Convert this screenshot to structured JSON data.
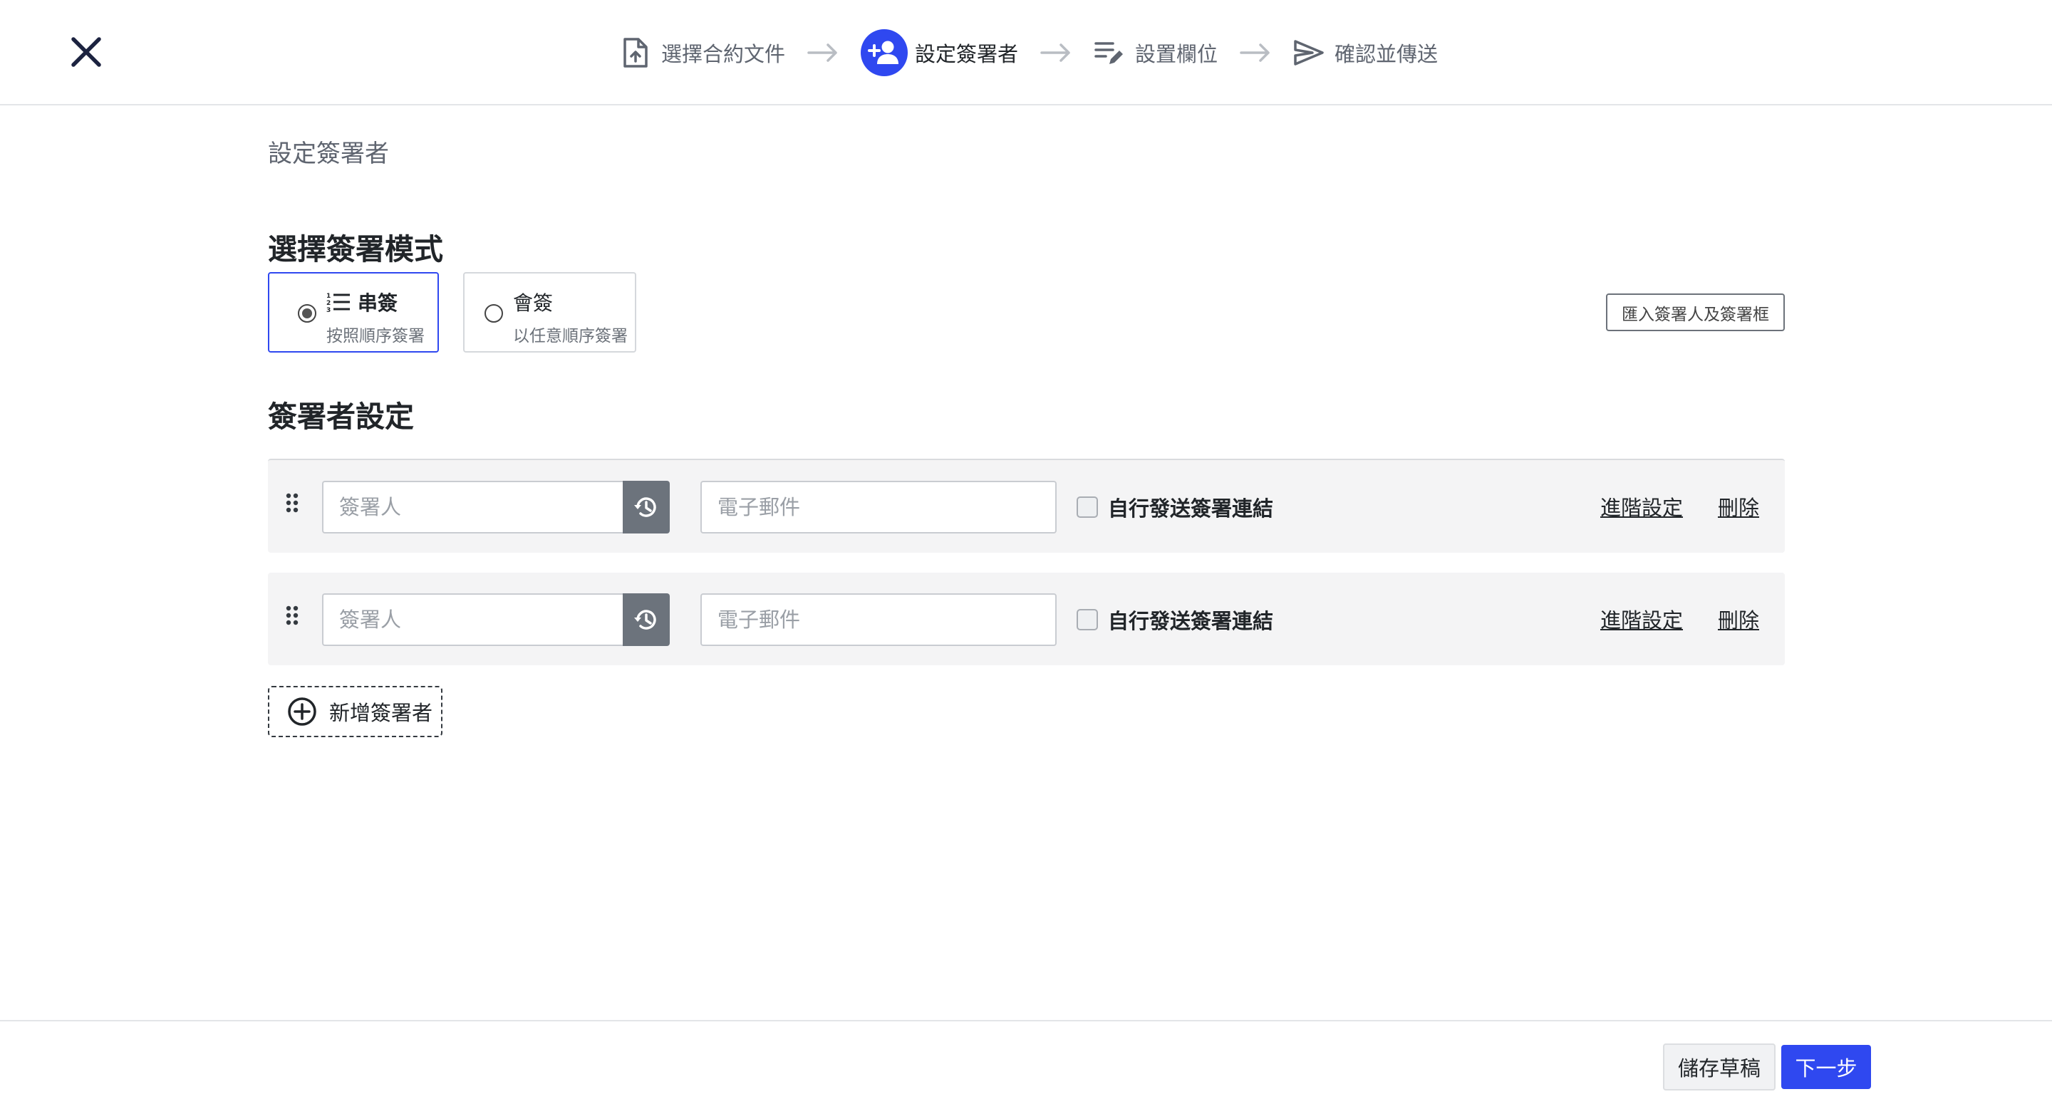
{
  "colors": {
    "accent": "#2f48f0",
    "history_button": "#6c737c",
    "row_background": "#f4f4f5"
  },
  "header": {
    "close_icon": "close-icon",
    "steps": [
      {
        "label": "選擇合約文件",
        "icon": "file-upload-icon",
        "active": false
      },
      {
        "label": "設定簽署者",
        "icon": "add-person-icon",
        "active": true
      },
      {
        "label": "設置欄位",
        "icon": "edit-list-icon",
        "active": false
      },
      {
        "label": "確認並傳送",
        "icon": "send-icon",
        "active": false
      }
    ]
  },
  "main": {
    "page_title": "設定簽署者",
    "mode_section": {
      "title": "選擇簽署模式",
      "options": [
        {
          "name": "串簽",
          "desc": "按照順序簽署",
          "icon": "ordered-list-icon",
          "selected": true
        },
        {
          "name": "會簽",
          "desc": "以任意順序簽署",
          "selected": false
        }
      ],
      "import_button": "匯入簽署人及簽署框"
    },
    "signer_section": {
      "title": "簽署者設定",
      "rows": [
        {
          "name_placeholder": "簽署人",
          "email_placeholder": "電子郵件",
          "self_send_label": "自行發送簽署連結",
          "self_send_checked": false,
          "advanced_label": "進階設定",
          "delete_label": "刪除"
        },
        {
          "name_placeholder": "簽署人",
          "email_placeholder": "電子郵件",
          "self_send_label": "自行發送簽署連結",
          "self_send_checked": false,
          "advanced_label": "進階設定",
          "delete_label": "刪除"
        }
      ],
      "add_button": "新增簽署者"
    }
  },
  "footer": {
    "save_draft": "儲存草稿",
    "next": "下一步"
  }
}
